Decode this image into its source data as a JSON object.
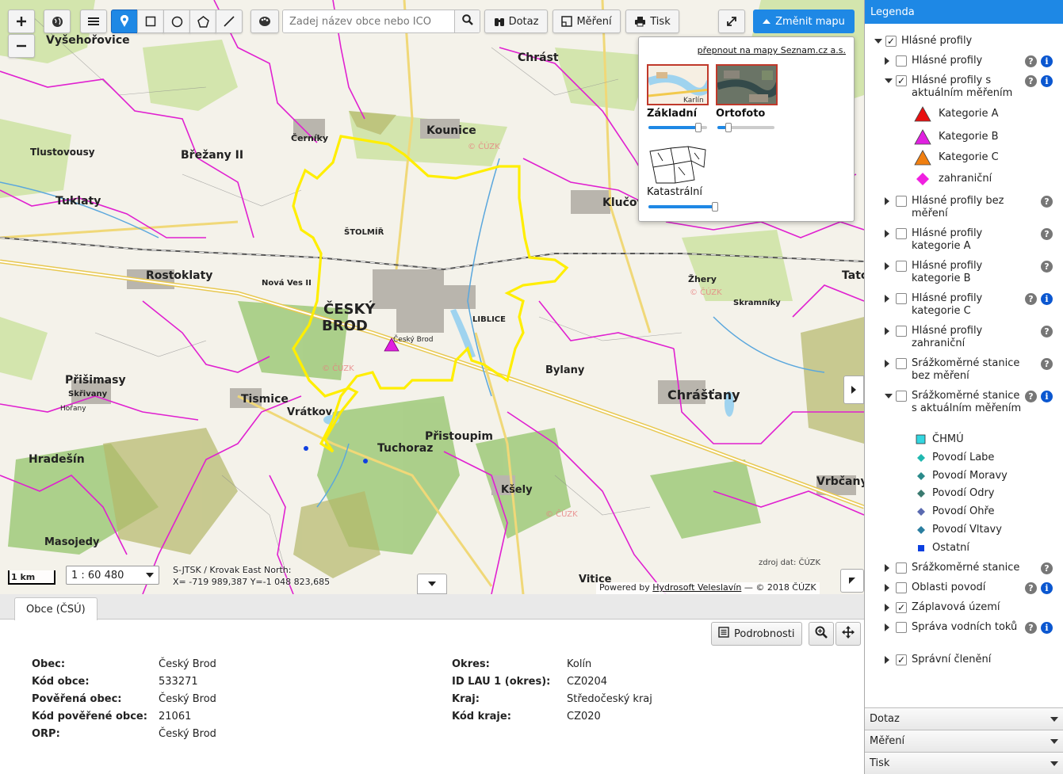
{
  "toolbar": {
    "search_placeholder": "Zadej název obce nebo IČO",
    "query_label": "Dotaz",
    "measure_label": "Měření",
    "print_label": "Tisk",
    "change_map_label": "Změnit mapu"
  },
  "maps_panel": {
    "seznam_link": "přepnout na mapy Seznam.cz a.s.",
    "basemaps": [
      {
        "label": "Základní",
        "thumb_text": "Karlín",
        "opacity": 0.85
      },
      {
        "label": "Ortofoto",
        "opacity": 0.2
      }
    ],
    "overlay": {
      "label": "Katastrální",
      "opacity": 1.0
    }
  },
  "map": {
    "scale_bar_label": "1 km",
    "scale_value": "1 : 60 480",
    "coord_system": "S-JTSK / Krovak East North:",
    "coords": "X= -719 989,387 Y=-1 048 823,685",
    "source_label": "zdroj dat: ČÚZK",
    "powered_prefix": "Powered by ",
    "powered_link": "Hydrosoft Veleslavín",
    "powered_suffix": " — © 2018 ČÚZK",
    "colors": {
      "admin_border": "#e020d0",
      "selected_boundary": "#ffee00",
      "profile_b": "#e020e0",
      "road": "#e6c84a"
    },
    "places": [
      {
        "name": "Vyšehořovice",
        "bold": true
      },
      {
        "name": "Chrást",
        "bold": true
      },
      {
        "name": "Kounice",
        "bold": true
      },
      {
        "name": "Břežany II",
        "bold": true
      },
      {
        "name": "Tlustovousy",
        "bold": true
      },
      {
        "name": "Tuklaty",
        "bold": true
      },
      {
        "name": "Rostoklaty",
        "bold": true
      },
      {
        "name": "ČESKÝ",
        "bold": true
      },
      {
        "name": "BROD",
        "bold": true
      },
      {
        "name": "Klučov",
        "bold": true
      },
      {
        "name": "Chrášťany",
        "bold": true
      },
      {
        "name": "Přišimasy",
        "bold": true
      },
      {
        "name": "Tismice",
        "bold": true
      },
      {
        "name": "Vrátkov",
        "bold": true
      },
      {
        "name": "Tuchoraz",
        "bold": true
      },
      {
        "name": "Přistoupim",
        "bold": true
      },
      {
        "name": "Hradešín",
        "bold": true
      },
      {
        "name": "Bylany",
        "bold": true
      },
      {
        "name": "Vrbčany",
        "bold": true
      },
      {
        "name": "Kšely",
        "bold": true
      },
      {
        "name": "Vitice",
        "bold": true
      },
      {
        "name": "Masojedy",
        "bold": true
      },
      {
        "name": "Černíky",
        "bold": false
      },
      {
        "name": "Štolmíř",
        "bold": false
      },
      {
        "name": "Nová Ves II",
        "bold": false
      },
      {
        "name": "Liblice",
        "bold": false
      },
      {
        "name": "Skřivany",
        "bold": false
      },
      {
        "name": "Hořany",
        "bold": false
      },
      {
        "name": "Žhery",
        "bold": false
      },
      {
        "name": "Skramníky",
        "bold": false
      },
      {
        "name": "Tatce",
        "bold": true
      },
      {
        "name": "Český Brod",
        "bold": false
      }
    ]
  },
  "legend": {
    "title": "Legenda",
    "items": [
      {
        "label": "Hlásné profily",
        "checked": true,
        "expanded": true,
        "help": false,
        "info": false
      },
      {
        "label": "Hlásné profily",
        "checked": false,
        "expanded": false,
        "help": true,
        "info": true
      },
      {
        "label": "Hlásné profily s aktuálním měřením",
        "checked": true,
        "expanded": true,
        "help": true,
        "info": true
      },
      {
        "label": "Hlásné profily bez měření",
        "checked": false,
        "expanded": false,
        "help": true,
        "info": false
      },
      {
        "label": "Hlásné profily kategorie A",
        "checked": false,
        "expanded": false,
        "help": true,
        "info": false
      },
      {
        "label": "Hlásné profily kategorie B",
        "checked": false,
        "expanded": false,
        "help": true,
        "info": false
      },
      {
        "label": "Hlásné profily kategorie C",
        "checked": false,
        "expanded": false,
        "help": true,
        "info": true
      },
      {
        "label": "Hlásné profily zahraniční",
        "checked": false,
        "expanded": false,
        "help": true,
        "info": false
      },
      {
        "label": "Srážkoměrné stanice bez měření",
        "checked": false,
        "expanded": false,
        "help": true,
        "info": false
      },
      {
        "label": "Srážkoměrné stanice s aktuálním měřením",
        "checked": false,
        "expanded": true,
        "help": true,
        "info": true
      },
      {
        "label": "Srážkoměrné stanice",
        "checked": false,
        "expanded": false,
        "help": true,
        "info": false
      },
      {
        "label": "Oblasti povodí",
        "checked": false,
        "expanded": false,
        "help": true,
        "info": true
      },
      {
        "label": "Záplavová území",
        "checked": true,
        "expanded": false,
        "help": false,
        "info": false
      },
      {
        "label": "Správa vodních toků",
        "checked": false,
        "expanded": false,
        "help": true,
        "info": true
      },
      {
        "label": "Správní členění",
        "checked": true,
        "expanded": false,
        "help": false,
        "info": false
      }
    ],
    "profile_symbols": [
      {
        "label": "Kategorie A",
        "color": "#e81010",
        "shape": "triangle"
      },
      {
        "label": "Kategorie B",
        "color": "#e020e0",
        "shape": "triangle"
      },
      {
        "label": "Kategorie C",
        "color": "#f07f10",
        "shape": "triangle"
      },
      {
        "label": "zahraniční",
        "color": "#f020e0",
        "shape": "diamond"
      }
    ],
    "station_symbols": [
      {
        "label": "ČHMÚ",
        "color": "#33d6e0",
        "shape": "square"
      },
      {
        "label": "Povodí Labe",
        "color": "#20b8b0",
        "shape": "diamond"
      },
      {
        "label": "Povodí Moravy",
        "color": "#2a8a8a",
        "shape": "diamond"
      },
      {
        "label": "Povodí Odry",
        "color": "#3a7a70",
        "shape": "diamond"
      },
      {
        "label": "Povodí Ohře",
        "color": "#5a6ab0",
        "shape": "diamond"
      },
      {
        "label": "Povodí Vltavy",
        "color": "#2a7ea0",
        "shape": "diamond"
      },
      {
        "label": "Ostatní",
        "color": "#0b3fe0",
        "shape": "smallsquare"
      }
    ],
    "accordions": [
      "Dotaz",
      "Měření",
      "Tisk"
    ]
  },
  "details": {
    "tab_label": "Obce (ČSÚ)",
    "detail_button": "Podrobnosti",
    "left": [
      {
        "key": "Obec",
        "value": "Český Brod"
      },
      {
        "key": "Kód obce",
        "value": "533271"
      },
      {
        "key": "Pověřená obec",
        "value": "Český Brod"
      },
      {
        "key": "Kód pověřené obce",
        "value": "21061"
      },
      {
        "key": "ORP",
        "value": "Český Brod"
      }
    ],
    "right": [
      {
        "key": "Okres",
        "value": "Kolín"
      },
      {
        "key": "ID LAU 1 (okres)",
        "value": "CZ0204"
      },
      {
        "key": "Kraj",
        "value": "Středočeský kraj"
      },
      {
        "key": "Kód kraje",
        "value": "CZ020"
      }
    ]
  }
}
